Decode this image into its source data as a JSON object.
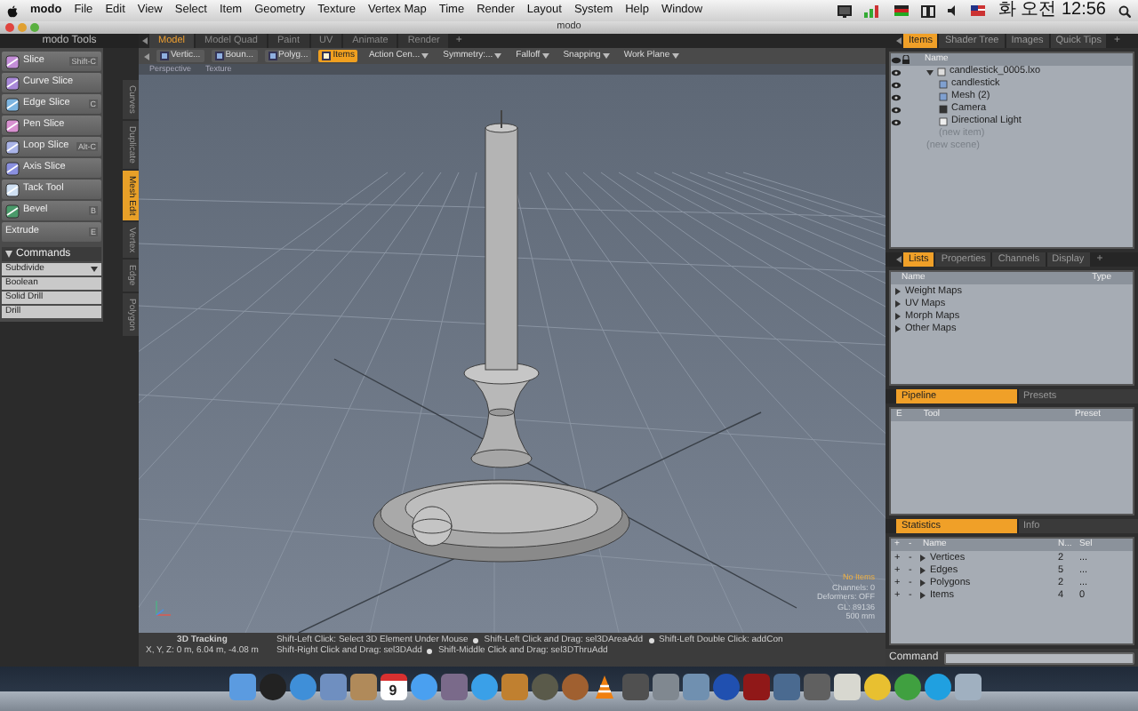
{
  "menu_bar": {
    "app": "modo",
    "items": [
      "File",
      "Edit",
      "View",
      "Select",
      "Item",
      "Geometry",
      "Texture",
      "Vertex Map",
      "Time",
      "Render",
      "Layout",
      "System",
      "Help",
      "Window"
    ],
    "clock": "화 오전 12:56"
  },
  "window": {
    "title": "modo"
  },
  "tools_panel": {
    "title": "modo Tools",
    "tools": [
      {
        "label": "Slice",
        "shortcut": "Shift-C",
        "kind": "slice"
      },
      {
        "label": "Curve Slice",
        "kind": "curve"
      },
      {
        "label": "Edge Slice",
        "shortcut": "C",
        "kind": "edge"
      },
      {
        "label": "Pen Slice",
        "kind": "pen"
      },
      {
        "label": "Loop Slice",
        "shortcut": "Alt-C",
        "kind": "loop"
      },
      {
        "label": "Axis Slice",
        "kind": "axis"
      },
      {
        "label": "Tack Tool",
        "kind": "tack"
      },
      {
        "label": "Bevel",
        "shortcut": "B",
        "kind": "bevel"
      },
      {
        "label": "Extrude",
        "shortcut": "E",
        "kind": "plain"
      }
    ],
    "commands_title": "Commands",
    "commands": [
      {
        "label": "Subdivide",
        "dropdown": true
      },
      {
        "label": "Boolean",
        "dropdown": false
      },
      {
        "label": "Solid Drill",
        "dropdown": false
      },
      {
        "label": "Drill",
        "dropdown": false
      }
    ]
  },
  "side_tabs": [
    {
      "label": "Curves",
      "selected": false
    },
    {
      "label": "Duplicate",
      "selected": false
    },
    {
      "label": "Mesh Edit",
      "selected": true
    },
    {
      "label": "Vertex",
      "selected": false
    },
    {
      "label": "Edge",
      "selected": false
    },
    {
      "label": "Polygon",
      "selected": false
    }
  ],
  "layout_tabs": {
    "tabs": [
      {
        "label": "Model",
        "selected": true
      },
      {
        "label": "Model Quad",
        "selected": false
      },
      {
        "label": "Paint",
        "selected": false
      },
      {
        "label": "UV",
        "selected": false
      },
      {
        "label": "Animate",
        "selected": false
      },
      {
        "label": "Render",
        "selected": false
      }
    ],
    "add_tab": "+"
  },
  "toolbar": [
    {
      "label": "Vertic...",
      "kind": "mode",
      "selected": false
    },
    {
      "label": "Boun...",
      "kind": "mode",
      "selected": false
    },
    {
      "label": "Polyg...",
      "kind": "mode",
      "selected": false
    },
    {
      "label": "Items",
      "kind": "mode",
      "selected": true
    },
    {
      "label": "Action Cen...",
      "kind": "dropdown"
    },
    {
      "label": "Symmetry:...",
      "kind": "dropdown"
    },
    {
      "label": "Falloff",
      "kind": "dropdown"
    },
    {
      "label": "Snapping",
      "kind": "dropdown"
    },
    {
      "label": "Work Plane",
      "kind": "dropdown"
    }
  ],
  "viewport": {
    "view": "Perspective",
    "shading": "Texture",
    "info": [
      {
        "text": "No Items",
        "kind": "warning"
      },
      {
        "text": "Channels: 0",
        "kind": "plain"
      },
      {
        "text": "Deformers: OFF",
        "kind": "plain"
      },
      {
        "text": "GL: 89136",
        "kind": "plain"
      },
      {
        "text": "500 mm",
        "kind": "plain"
      }
    ]
  },
  "status_bar": {
    "title": "3D Tracking",
    "coords": "X, Y, Z:  0 m, 6.04 m, -4.08 m",
    "hints": [
      [
        "Shift-Left Click: Select 3D Element Under Mouse",
        "Shift-Left Click and Drag: sel3DAreaAdd",
        "Shift-Left Double Click: addCon"
      ],
      [
        "Shift-Right Click and Drag: sel3DAdd",
        "Shift-Middle Click and Drag: sel3DThruAdd"
      ]
    ]
  },
  "items_panel": {
    "tabs": [
      {
        "label": "Items",
        "selected": true
      },
      {
        "label": "Shader Tree",
        "selected": false
      },
      {
        "label": "Images",
        "selected": false
      },
      {
        "label": "Quick Tips",
        "selected": false
      }
    ],
    "add_tab": "+",
    "column": "Name",
    "tree": [
      {
        "label": "candlestick_0005.lxo",
        "kind": "scene",
        "expanded": true,
        "children": [
          {
            "label": "candlestick",
            "kind": "locator"
          },
          {
            "label": "Mesh (2)",
            "kind": "mesh"
          },
          {
            "label": "Camera",
            "kind": "camera"
          },
          {
            "label": "Directional Light",
            "kind": "light"
          },
          {
            "label": "(new item)",
            "kind": "placeholder"
          }
        ]
      },
      {
        "label": "(new scene)",
        "kind": "placeholder"
      }
    ]
  },
  "lists_panel": {
    "tabs": [
      {
        "label": "Lists",
        "selected": true
      },
      {
        "label": "Properties",
        "selected": false
      },
      {
        "label": "Channels",
        "selected": false
      },
      {
        "label": "Display",
        "selected": false
      }
    ],
    "add_tab": "+",
    "columns": [
      "Name",
      "Type"
    ],
    "rows": [
      {
        "label": "Weight Maps",
        "expanded": false
      },
      {
        "label": "UV Maps",
        "expanded": false
      },
      {
        "label": "Morph Maps",
        "expanded": false
      },
      {
        "label": "Other Maps",
        "expanded": false
      }
    ]
  },
  "pipeline_panel": {
    "tabs": [
      {
        "label": "Pipeline",
        "selected": true
      },
      {
        "label": "Presets",
        "selected": false
      }
    ],
    "columns": [
      "E",
      "Tool",
      "Preset"
    ]
  },
  "statistics_panel": {
    "tabs": [
      {
        "label": "Statistics",
        "selected": true
      },
      {
        "label": "Info",
        "selected": false
      }
    ],
    "columns": [
      "+",
      "-",
      "Name",
      "N...",
      "Sel"
    ],
    "rows": [
      {
        "plus": "+",
        "minus": "-",
        "name": "Vertices",
        "count": "2",
        "sel": "..."
      },
      {
        "plus": "+",
        "minus": "-",
        "name": "Edges",
        "count": "5",
        "sel": "..."
      },
      {
        "plus": "+",
        "minus": "-",
        "name": "Polygons",
        "count": "2",
        "sel": "..."
      },
      {
        "plus": "+",
        "minus": "-",
        "name": "Items",
        "count": "4",
        "sel": "0"
      }
    ]
  },
  "command_bar": {
    "label": "Command"
  },
  "dock": {
    "apps": [
      {
        "kind": "square",
        "color": "#5b9be0"
      },
      {
        "kind": "round",
        "color": "#222222"
      },
      {
        "kind": "round",
        "color": "#3f8fd8"
      },
      {
        "kind": "square",
        "color": "#6f8fc0"
      },
      {
        "kind": "square",
        "color": "#b08a5a"
      },
      {
        "kind": "calendar",
        "color": "#d83030",
        "label": "9"
      },
      {
        "kind": "round",
        "color": "#4aa0f0"
      },
      {
        "kind": "square",
        "color": "#7a6a8a"
      },
      {
        "kind": "round",
        "color": "#3aa0e8"
      },
      {
        "kind": "square",
        "color": "#c08030"
      },
      {
        "kind": "round",
        "color": "#5a5a4a"
      },
      {
        "kind": "round",
        "color": "#a06030"
      },
      {
        "kind": "cone",
        "color": "#f08010"
      },
      {
        "kind": "square",
        "color": "#505050"
      },
      {
        "kind": "square",
        "color": "#808890"
      },
      {
        "kind": "square",
        "color": "#7090b0"
      },
      {
        "kind": "round",
        "color": "#2050b0"
      },
      {
        "kind": "square",
        "color": "#901818"
      },
      {
        "kind": "square",
        "color": "#4a6a90"
      },
      {
        "kind": "square",
        "color": "#606060"
      },
      {
        "kind": "square",
        "color": "#d8d8d0"
      },
      {
        "kind": "round",
        "color": "#e8c030"
      },
      {
        "kind": "round",
        "color": "#40a040"
      },
      {
        "kind": "round",
        "color": "#20a0e0"
      },
      {
        "kind": "square",
        "color": "#a0b0c0"
      }
    ]
  }
}
